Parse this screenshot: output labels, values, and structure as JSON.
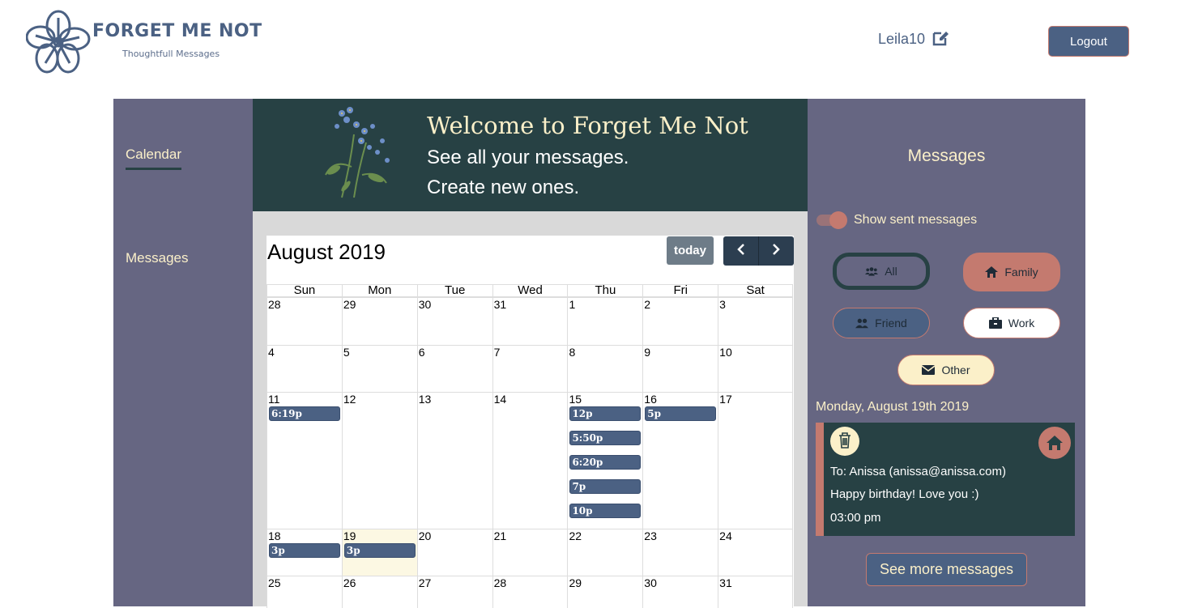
{
  "brand": {
    "title": "FORGET ME NOT",
    "subtitle": "Thoughtfull Messages"
  },
  "header": {
    "username": "Leila10",
    "logout_label": "Logout"
  },
  "nav": {
    "calendar_label": "Calendar",
    "messages_label": "Messages"
  },
  "banner": {
    "title": "Welcome to Forget Me Not",
    "line1": "See all your messages.",
    "line2": "Create new ones."
  },
  "calendar": {
    "title": "August 2019",
    "today_label": "today",
    "days_of_week": [
      "Sun",
      "Mon",
      "Tue",
      "Wed",
      "Thu",
      "Fri",
      "Sat"
    ],
    "weeks": [
      {
        "days": [
          "28",
          "29",
          "30",
          "31",
          "1",
          "2",
          "3"
        ],
        "height": 59,
        "events": []
      },
      {
        "days": [
          "4",
          "5",
          "6",
          "7",
          "8",
          "9",
          "10"
        ],
        "height": 58,
        "events": []
      },
      {
        "days": [
          "11",
          "12",
          "13",
          "14",
          "15",
          "16",
          "17"
        ],
        "height": 169,
        "events": [
          {
            "day": 0,
            "slot": 0,
            "label": "6:19p"
          },
          {
            "day": 4,
            "slot": 0,
            "label": "12p"
          },
          {
            "day": 4,
            "slot": 1,
            "label": "5:50p"
          },
          {
            "day": 4,
            "slot": 2,
            "label": "6:20p"
          },
          {
            "day": 4,
            "slot": 3,
            "label": "7p"
          },
          {
            "day": 4,
            "slot": 4,
            "label": "10p"
          },
          {
            "day": 5,
            "slot": 0,
            "label": "5p"
          }
        ]
      },
      {
        "days": [
          "18",
          "19",
          "20",
          "21",
          "22",
          "23",
          "24"
        ],
        "height": 58,
        "today": 1,
        "events": [
          {
            "day": 0,
            "slot": 0,
            "label": "3p"
          },
          {
            "day": 1,
            "slot": 0,
            "label": "3p"
          }
        ]
      },
      {
        "days": [
          "25",
          "26",
          "27",
          "28",
          "29",
          "30",
          "31"
        ],
        "height": 40,
        "events": []
      }
    ]
  },
  "messages_panel": {
    "title": "Messages",
    "toggle_label": "Show sent messages",
    "filters": {
      "all": "All",
      "family": "Family",
      "friend": "Friend",
      "work": "Work",
      "other": "Other"
    },
    "date_heading": "Monday, August 19th 2019",
    "card": {
      "to": "To: Anissa (anissa@anissa.com)",
      "body": "Happy birthday! Love you :)",
      "time": "03:00 pm"
    },
    "see_more_label": "See more messages"
  },
  "colors": {
    "navy": "#4b6183",
    "slate": "#666682",
    "dark_teal": "#274144",
    "cream": "#fbf0c9",
    "rose": "#c47a6f"
  },
  "icons": {
    "logo": "flower-logo-icon",
    "edit": "edit-icon",
    "trash": "trash-icon",
    "family": "home-icon",
    "friend": "users-icon",
    "work": "briefcase-icon",
    "other": "envelope-icon"
  }
}
